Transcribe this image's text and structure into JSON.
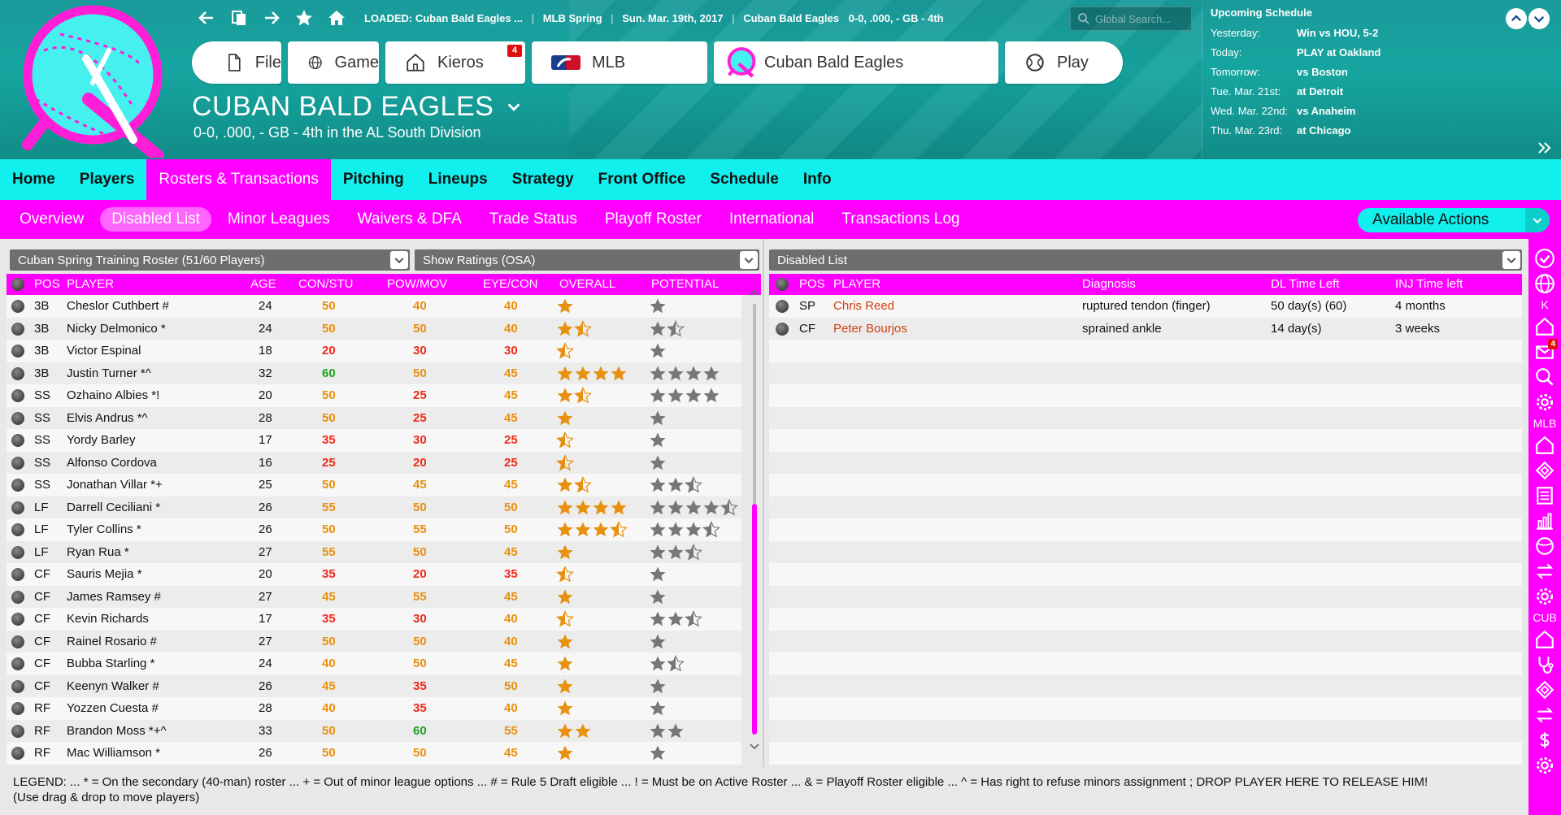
{
  "colors": {
    "accent_magenta": "#ff00ff",
    "accent_cyan": "#12f0ee",
    "header_teal": "#16a5a0",
    "star_gold": "#e89010",
    "star_gray": "#777777",
    "name_injured": "#d04010"
  },
  "topbar": {
    "loaded_label": "LOADED:",
    "loaded_team": "Cuban Bald Eagles ...",
    "league": "MLB Spring",
    "date": "Sun. Mar. 19th, 2017",
    "team": "Cuban Bald Eagles",
    "record": "0-0, .000, - GB - 4th",
    "search_placeholder": "Global Search..."
  },
  "main_buttons": {
    "file": "File",
    "game": "Game",
    "kieros": "Kieros",
    "kieros_badge": "4",
    "mlb": "MLB",
    "team": "Cuban Bald Eagles",
    "play": "Play"
  },
  "team_header": {
    "title": "CUBAN BALD EAGLES",
    "subtitle": "0-0, .000, - GB - 4th in the AL South Division"
  },
  "schedule": {
    "title": "Upcoming Schedule",
    "rows": [
      {
        "day": "Yesterday:",
        "value": "Win vs HOU, 5-2"
      },
      {
        "day": "Today:",
        "value": "PLAY at Oakland"
      },
      {
        "day": "Tomorrow:",
        "value": "vs Boston"
      },
      {
        "day": "Tue. Mar. 21st:",
        "value": "at Detroit"
      },
      {
        "day": "Wed. Mar. 22nd:",
        "value": "vs Anaheim"
      },
      {
        "day": "Thu. Mar. 23rd:",
        "value": "at Chicago"
      }
    ]
  },
  "nav_primary": [
    "Home",
    "Players",
    "Rosters & Transactions",
    "Pitching",
    "Lineups",
    "Strategy",
    "Front Office",
    "Schedule",
    "Info"
  ],
  "nav_primary_active": 2,
  "nav_secondary": [
    "Overview",
    "Disabled List",
    "Minor Leagues",
    "Waivers & DFA",
    "Trade Status",
    "Playoff Roster",
    "International",
    "Transactions Log"
  ],
  "nav_secondary_active": 1,
  "available_actions": "Available Actions",
  "left": {
    "roster_select": "Cuban Spring Training Roster (51/60 Players)",
    "ratings_select": "Show Ratings (OSA)",
    "columns": [
      "POS",
      "PLAYER",
      "AGE",
      "CON/STU",
      "POW/MOV",
      "EYE/CON",
      "OVERALL",
      "POTENTIAL"
    ],
    "rows": [
      {
        "pos": "3B",
        "name": "Cheslor Cuthbert #",
        "age": "24",
        "con": "50",
        "pow": "40",
        "eye": "40",
        "overall": 1.0,
        "potential": 1.0
      },
      {
        "pos": "3B",
        "name": "Nicky Delmonico *",
        "age": "24",
        "con": "50",
        "pow": "50",
        "eye": "40",
        "overall": 1.5,
        "potential": 1.5
      },
      {
        "pos": "3B",
        "name": "Victor Espinal",
        "age": "18",
        "con": "20",
        "pow": "30",
        "eye": "30",
        "overall": 0.5,
        "potential": 1.0
      },
      {
        "pos": "3B",
        "name": "Justin Turner *^",
        "age": "32",
        "con": "60",
        "pow": "50",
        "eye": "45",
        "overall": 4.0,
        "potential": 4.0
      },
      {
        "pos": "SS",
        "name": "Ozhaino Albies *!",
        "age": "20",
        "con": "50",
        "pow": "25",
        "eye": "45",
        "overall": 1.5,
        "potential": 4.0
      },
      {
        "pos": "SS",
        "name": "Elvis Andrus *^",
        "age": "28",
        "con": "50",
        "pow": "25",
        "eye": "45",
        "overall": 1.0,
        "potential": 1.0
      },
      {
        "pos": "SS",
        "name": "Yordy Barley",
        "age": "17",
        "con": "35",
        "pow": "30",
        "eye": "25",
        "overall": 0.5,
        "potential": 1.0
      },
      {
        "pos": "SS",
        "name": "Alfonso Cordova",
        "age": "16",
        "con": "25",
        "pow": "20",
        "eye": "25",
        "overall": 0.5,
        "potential": 1.0
      },
      {
        "pos": "SS",
        "name": "Jonathan Villar *+",
        "age": "25",
        "con": "50",
        "pow": "45",
        "eye": "45",
        "overall": 1.5,
        "potential": 2.5
      },
      {
        "pos": "LF",
        "name": "Darrell Ceciliani *",
        "age": "26",
        "con": "55",
        "pow": "50",
        "eye": "50",
        "overall": 4.0,
        "potential": 4.5
      },
      {
        "pos": "LF",
        "name": "Tyler Collins *",
        "age": "26",
        "con": "50",
        "pow": "55",
        "eye": "50",
        "overall": 3.5,
        "potential": 3.5
      },
      {
        "pos": "LF",
        "name": "Ryan Rua *",
        "age": "27",
        "con": "55",
        "pow": "50",
        "eye": "45",
        "overall": 1.0,
        "potential": 2.5
      },
      {
        "pos": "CF",
        "name": "Sauris Mejia *",
        "age": "20",
        "con": "35",
        "pow": "20",
        "eye": "35",
        "overall": 0.5,
        "potential": 1.0
      },
      {
        "pos": "CF",
        "name": "James Ramsey #",
        "age": "27",
        "con": "45",
        "pow": "55",
        "eye": "45",
        "overall": 1.0,
        "potential": 1.0
      },
      {
        "pos": "CF",
        "name": "Kevin Richards",
        "age": "17",
        "con": "35",
        "pow": "30",
        "eye": "40",
        "overall": 0.5,
        "potential": 2.5
      },
      {
        "pos": "CF",
        "name": "Rainel Rosario #",
        "age": "27",
        "con": "50",
        "pow": "50",
        "eye": "40",
        "overall": 1.0,
        "potential": 1.0
      },
      {
        "pos": "CF",
        "name": "Bubba Starling *",
        "age": "24",
        "con": "40",
        "pow": "50",
        "eye": "45",
        "overall": 1.0,
        "potential": 1.5
      },
      {
        "pos": "CF",
        "name": "Keenyn Walker #",
        "age": "26",
        "con": "45",
        "pow": "35",
        "eye": "50",
        "overall": 1.0,
        "potential": 1.0
      },
      {
        "pos": "RF",
        "name": "Yozzen Cuesta #",
        "age": "28",
        "con": "40",
        "pow": "35",
        "eye": "40",
        "overall": 1.0,
        "potential": 1.0
      },
      {
        "pos": "RF",
        "name": "Brandon Moss *+^",
        "age": "33",
        "con": "50",
        "pow": "60",
        "eye": "55",
        "overall": 2.0,
        "potential": 2.0
      },
      {
        "pos": "RF",
        "name": "Mac Williamson *",
        "age": "26",
        "con": "50",
        "pow": "50",
        "eye": "45",
        "overall": 1.0,
        "potential": 1.0
      }
    ]
  },
  "right": {
    "list_select": "Disabled List",
    "columns": [
      "POS",
      "PLAYER",
      "Diagnosis",
      "DL Time Left",
      "INJ Time left"
    ],
    "rows": [
      {
        "pos": "SP",
        "name": "Chris Reed",
        "diagnosis": "ruptured tendon (finger)",
        "dl": "50 day(s) (60)",
        "inj": "4 months"
      },
      {
        "pos": "CF",
        "name": "Peter Bourjos",
        "diagnosis": "sprained ankle",
        "dl": "14 day(s)",
        "inj": "3 weeks"
      }
    ]
  },
  "legend": {
    "line1": "LEGEND:  ... * = On the secondary (40-man) roster    ... + = Out of minor league options    ... # = Rule 5 Draft eligible    ... ! = Must be on Active Roster    ... & = Playoff Roster eligible    ... ^ = Has right to refuse minors assignment  ; DROP PLAYER HERE TO RELEASE HIM!",
    "line2": "(Use drag & drop to move players)"
  },
  "sidebar": {
    "label_k": "K",
    "label_mlb": "MLB",
    "label_cub": "CUB",
    "mail_badge": "4",
    "icons_top": [
      "check-icon",
      "globe-icon"
    ],
    "icons_k": [
      "home-icon",
      "mail-icon",
      "search-icon",
      "gear-icon"
    ],
    "icons_mlb": [
      "home-icon",
      "diamond-icon",
      "list-icon",
      "bar-chart-icon",
      "baseball-icon",
      "transfer-icon",
      "gear-icon"
    ],
    "icons_cub": [
      "home-icon",
      "stethoscope-icon",
      "diamond-icon",
      "transfer-icon",
      "dollar-icon",
      "gear-icon"
    ]
  }
}
